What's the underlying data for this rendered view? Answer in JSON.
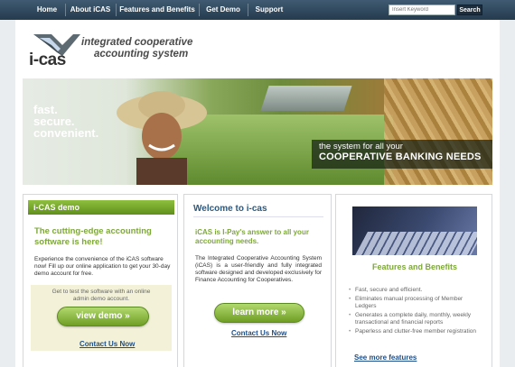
{
  "nav": {
    "items": [
      "Home",
      "About iCAS",
      "Features and Benefits",
      "Get Demo",
      "Support"
    ],
    "search_placeholder": "Insert Keyword",
    "search_button": "Search"
  },
  "logo": {
    "word": "i-cas",
    "tagline_line1": "integrated cooperative",
    "tagline_line2": "accounting system"
  },
  "banner": {
    "left_line1": "fast.",
    "left_line2": "secure.",
    "left_line3": "convenient.",
    "right_line1": "the system for all your",
    "right_line2": "COOPERATIVE BANKING NEEDS"
  },
  "demo": {
    "heading": "i-CAS demo",
    "title": "The cutting-edge accounting software is here!",
    "body": "Experience the convenience of the iCAS software now! Fill up our online application to get your 30-day demo account for free.",
    "box_text": "Get to test the software with an online admin demo account.",
    "button": "view demo »",
    "link": "Contact Us Now"
  },
  "welcome": {
    "title": "Welcome to i-cas",
    "lead": "iCAS is I-Pay's answer to all your accounting needs.",
    "body": "The Integrated Cooperative Accounting System (iCAS) is a user-friendly and fully integrated software designed and developed exclusively for Finance Accounting for Cooperatives.",
    "button": "learn more »",
    "link": "Contact Us Now"
  },
  "features": {
    "title": "Features and Benefits",
    "items": [
      "Fast, secure and efficient.",
      "Eliminates manual processing of Member Ledgers",
      "Generates a complete daily, monthly, weekly transactional and financial reports",
      "Paperless and clutter-free member registration"
    ],
    "link": "See more features"
  },
  "colors": {
    "nav_bg": "#2f4659",
    "accent_green": "#7ea83a",
    "link_blue": "#1d4f8a",
    "title_blue": "#2a5a82"
  }
}
